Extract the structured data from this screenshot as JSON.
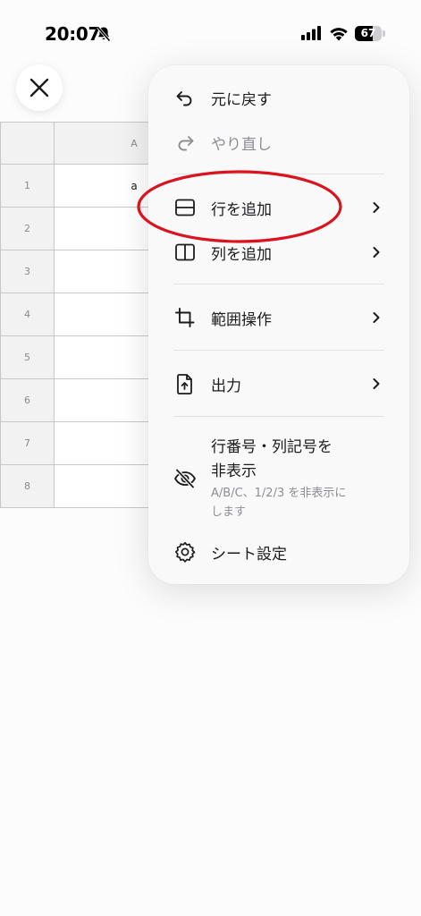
{
  "status_bar": {
    "time": "20:07",
    "battery_level": "67",
    "battery_fraction": 0.67,
    "icons": [
      "bell-slash-icon",
      "cellular-signal-icon",
      "wifi-icon",
      "battery-icon"
    ]
  },
  "grid": {
    "column_header": "A",
    "rows": [
      {
        "num": "1",
        "value": "a"
      },
      {
        "num": "2",
        "value": ""
      },
      {
        "num": "3",
        "value": ""
      },
      {
        "num": "4",
        "value": ""
      },
      {
        "num": "5",
        "value": ""
      },
      {
        "num": "6",
        "value": ""
      },
      {
        "num": "7",
        "value": ""
      },
      {
        "num": "8",
        "value": ""
      }
    ]
  },
  "menu": {
    "undo": "元に戻す",
    "redo": "やり直し",
    "add_row": "行を追加",
    "add_column": "列を追加",
    "range_ops": "範囲操作",
    "output": "出力",
    "hide_headers_line1": "行番号・列記号を",
    "hide_headers_line2": "非表示",
    "hide_headers_desc_line1": "A/B/C、1/2/3 を非表示に",
    "hide_headers_desc_line2": "します",
    "sheet_settings": "シート設定"
  },
  "colors": {
    "annotation": "#d9141f",
    "menu_bg": "#f9f9fa",
    "text": "#1c1c1e",
    "muted": "#8e8e93"
  }
}
